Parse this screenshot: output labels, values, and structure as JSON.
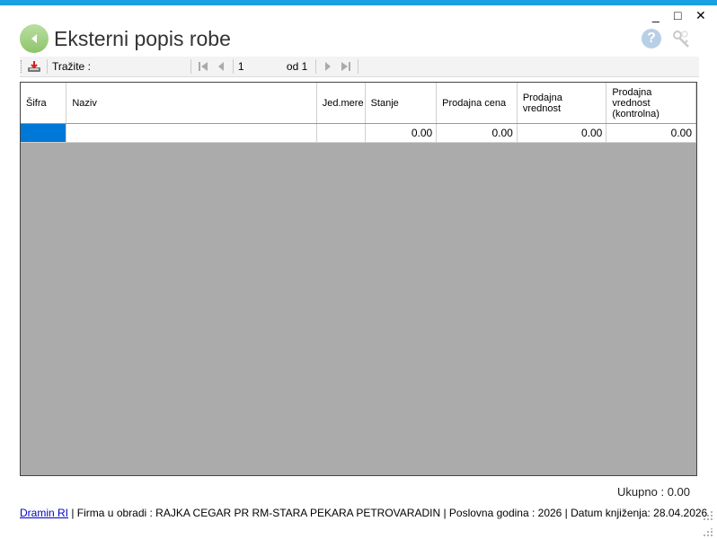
{
  "window": {
    "minimize_label": "_",
    "maximize_label": "□",
    "close_label": "✕"
  },
  "header": {
    "title": "Eksterni popis robe",
    "help_label": "?"
  },
  "toolbar": {
    "search_label": "Tražite :",
    "search_value": "",
    "page_current": "1",
    "page_of": "od 1"
  },
  "grid": {
    "columns": [
      "Šifra",
      "Naziv",
      "Jed.mere",
      "Stanje",
      "Prodajna cena",
      "Prodajna vrednost",
      "Prodajna vrednost (kontrolna)"
    ],
    "rows": [
      [
        "",
        "",
        "",
        "0.00",
        "0.00",
        "0.00",
        "0.00"
      ]
    ]
  },
  "summary": {
    "total": "Ukupno : 0.00"
  },
  "status": {
    "link": "Dramin RI",
    "info": "| Firma u obradi : RAJKA CEGAR PR RM-STARA PEKARA PETROVARADIN | Poslovna godina : 2026 | Datum knjiženja: 28.04.2026"
  },
  "colors": {
    "accent": "#1ba1e2",
    "selection": "#0078d7",
    "empty_area": "#ababab"
  }
}
